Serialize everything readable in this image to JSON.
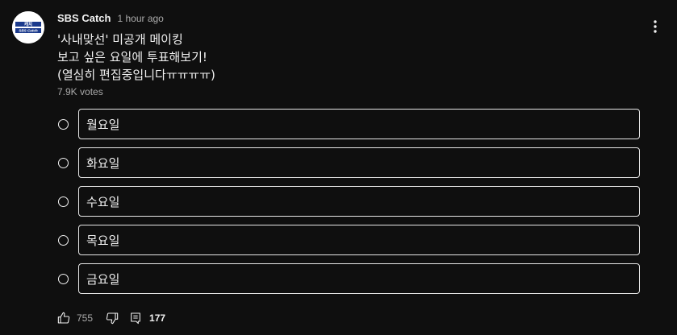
{
  "channel": {
    "name": "SBS Catch",
    "time": "1 hour ago",
    "avatar_text_top": "캐치",
    "avatar_text_bottom": "SBS Catch"
  },
  "post": {
    "lines": [
      "'사내맞선' 미공개 메이킹",
      "보고 싶은 요일에 투표해보기!",
      "(열심히 편집중입니다ㅠㅠㅠㅠ)"
    ],
    "votes": "7.9K votes"
  },
  "poll": {
    "options": [
      "월요일",
      "화요일",
      "수요일",
      "목요일",
      "금요일"
    ]
  },
  "actions": {
    "like_count": "755",
    "comment_count": "177"
  },
  "colors": {
    "background": "#0f0f0f",
    "text": "#f1f1f1",
    "muted": "#aaaaaa",
    "avatar_brand": "#1b3a8c"
  },
  "icons": {
    "more": "more-vert-icon",
    "like": "thumb-up-icon",
    "dislike": "thumb-down-icon",
    "comment": "comment-icon"
  }
}
